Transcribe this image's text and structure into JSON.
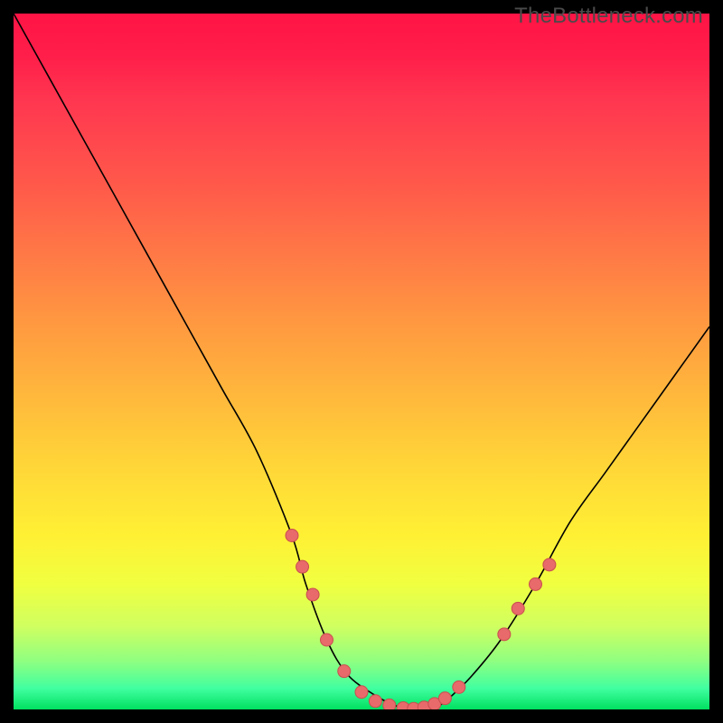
{
  "watermark": "TheBottleneck.com",
  "colors": {
    "background": "#000000",
    "curve": "#000000",
    "marker_fill": "#e86a6a",
    "marker_stroke": "#c94f4f"
  },
  "chart_data": {
    "type": "line",
    "title": "",
    "xlabel": "",
    "ylabel": "",
    "xlim": [
      0,
      100
    ],
    "ylim": [
      0,
      100
    ],
    "grid": false,
    "series": [
      {
        "name": "bottleneck-curve",
        "x": [
          0,
          5,
          10,
          15,
          20,
          25,
          30,
          35,
          40,
          42,
          45,
          48,
          52,
          55,
          58,
          61,
          63,
          66,
          70,
          75,
          80,
          85,
          90,
          95,
          100
        ],
        "y": [
          100,
          91,
          82,
          73,
          64,
          55,
          46,
          37,
          25,
          18,
          10,
          5,
          2,
          0.5,
          0,
          0.5,
          2,
          5,
          10,
          18,
          27,
          34,
          41,
          48,
          55
        ]
      }
    ],
    "markers": [
      {
        "x": 40.0,
        "y": 25.0
      },
      {
        "x": 41.5,
        "y": 20.5
      },
      {
        "x": 43.0,
        "y": 16.5
      },
      {
        "x": 45.0,
        "y": 10.0
      },
      {
        "x": 47.5,
        "y": 5.5
      },
      {
        "x": 50.0,
        "y": 2.5
      },
      {
        "x": 52.0,
        "y": 1.2
      },
      {
        "x": 54.0,
        "y": 0.6
      },
      {
        "x": 56.0,
        "y": 0.2
      },
      {
        "x": 57.5,
        "y": 0.1
      },
      {
        "x": 59.0,
        "y": 0.3
      },
      {
        "x": 60.5,
        "y": 0.8
      },
      {
        "x": 62.0,
        "y": 1.6
      },
      {
        "x": 64.0,
        "y": 3.2
      },
      {
        "x": 70.5,
        "y": 10.8
      },
      {
        "x": 72.5,
        "y": 14.5
      },
      {
        "x": 75.0,
        "y": 18.0
      },
      {
        "x": 77.0,
        "y": 20.8
      }
    ]
  }
}
